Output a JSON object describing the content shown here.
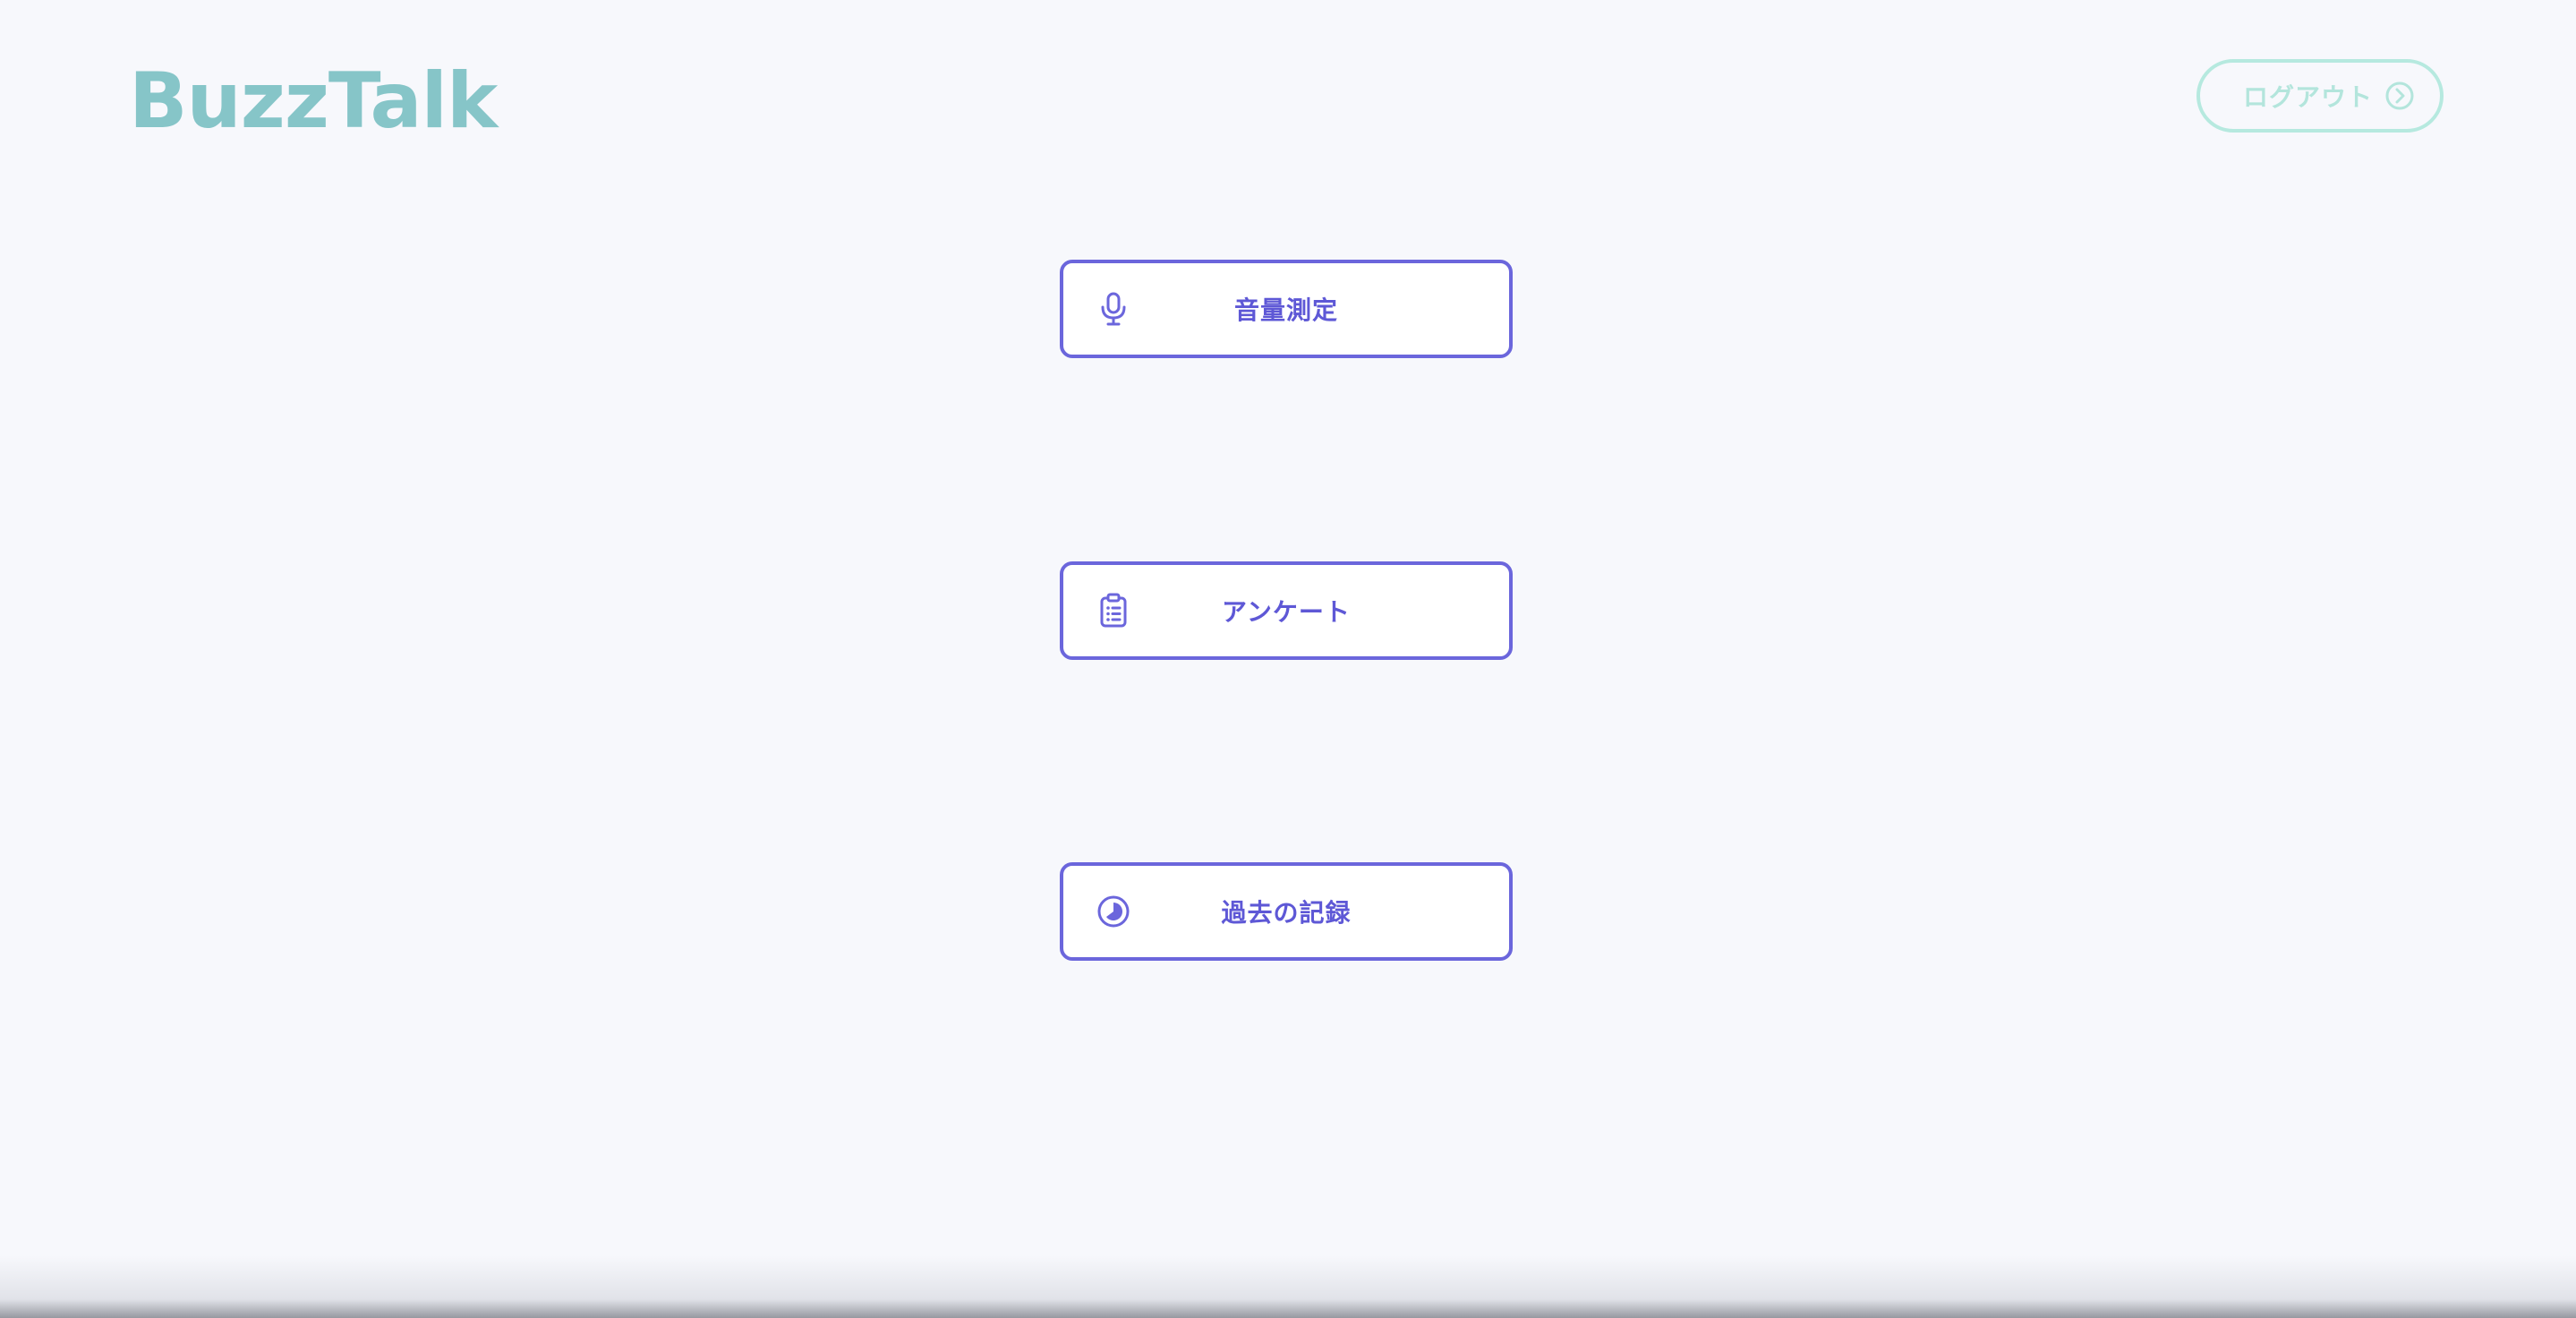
{
  "app": {
    "brand_name": "BuzzTalk"
  },
  "header": {
    "logout_label": "ログアウト",
    "logout_icon": "chevron-right-circle-icon"
  },
  "menu": {
    "items": [
      {
        "label": "音量測定",
        "icon": "microphone-icon"
      },
      {
        "label": "アンケート",
        "icon": "clipboard-list-icon"
      },
      {
        "label": "過去の記録",
        "icon": "history-pie-icon"
      }
    ]
  },
  "colors": {
    "background": "#f7f8fc",
    "brand": "#86c5c8",
    "logout_border": "#b6e9df",
    "logout_text": "#b3e5dc",
    "accent": "#6b66dc",
    "button_text": "#5e58d6",
    "button_bg": "#ffffff"
  }
}
